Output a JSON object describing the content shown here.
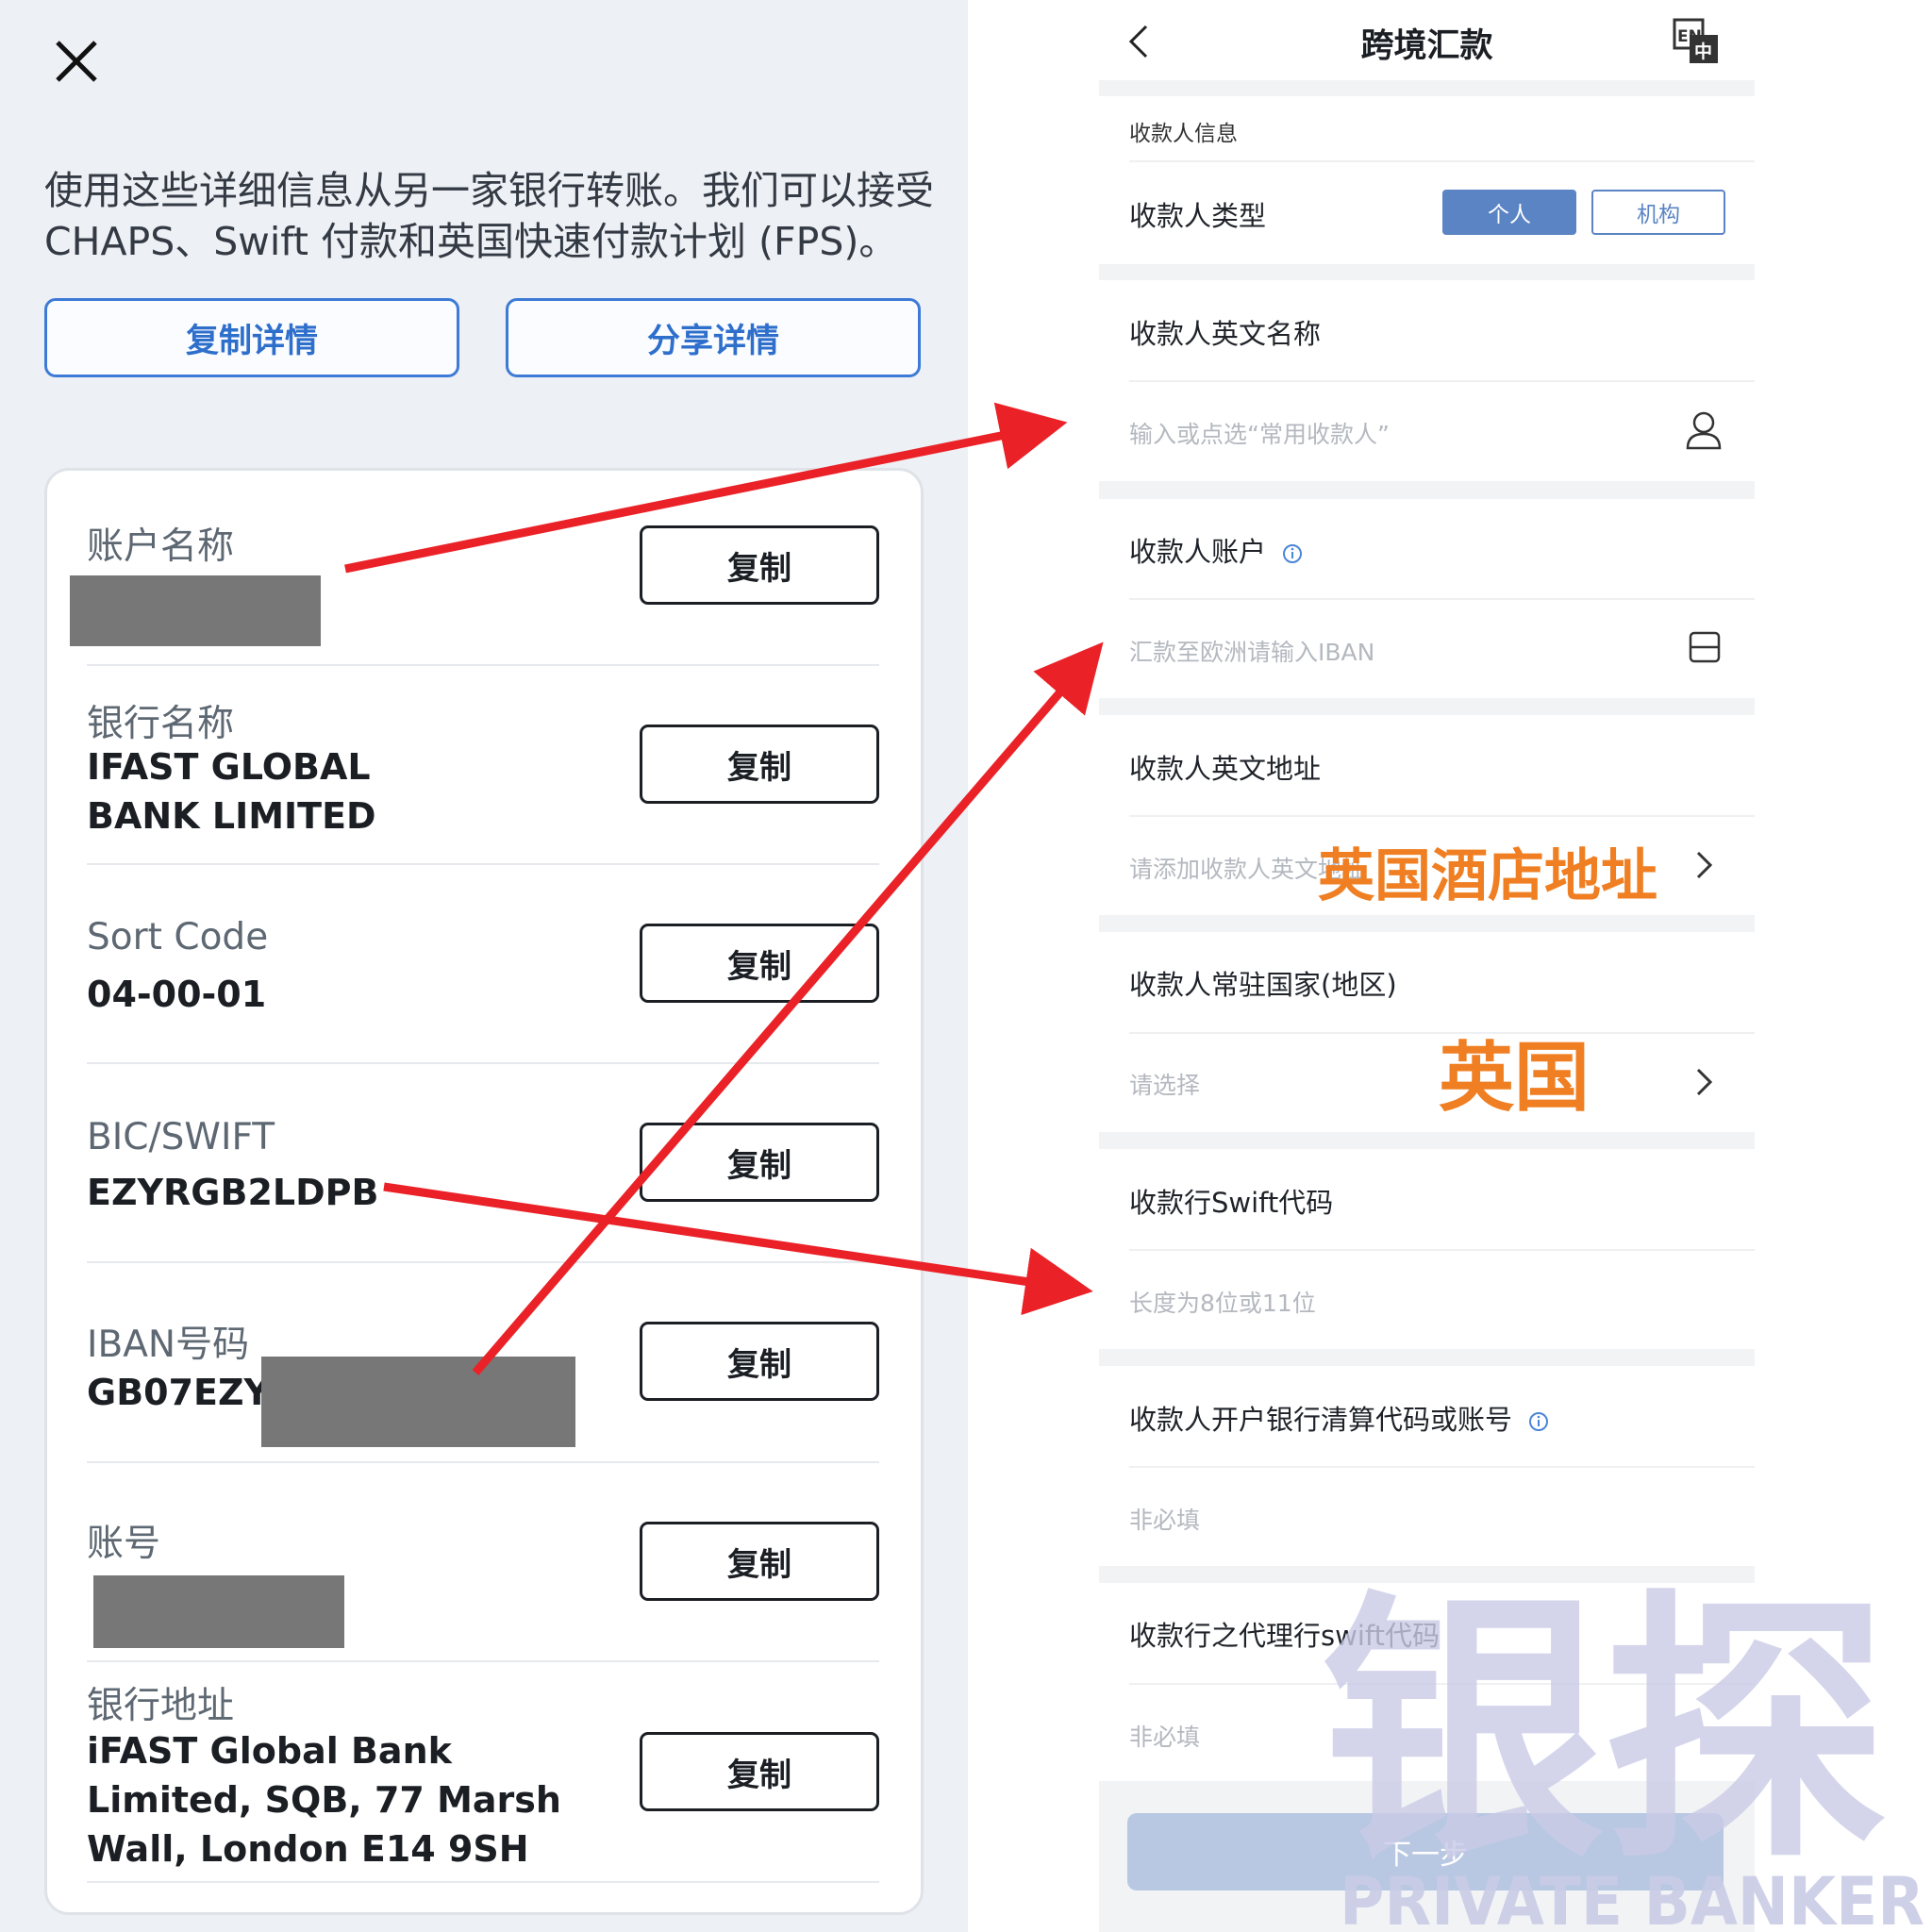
{
  "left_panel": {
    "intro": "使用这些详细信息从另一家银行转账。我们可以接受CHAPS、Swift 付款和英国快速付款计划 (FPS)。",
    "copy_details_label": "复制详情",
    "share_details_label": "分享详情",
    "copy_label": "复制",
    "details": [
      {
        "label": "账户名称",
        "value": ""
      },
      {
        "label": "银行名称",
        "value": "IFAST GLOBAL BANK LIMITED"
      },
      {
        "label": "Sort Code",
        "value": "04-00-01"
      },
      {
        "label": "BIC/SWIFT",
        "value": "EZYRGB2LDPB"
      },
      {
        "label": "IBAN号码",
        "value": "GB07EZYF"
      },
      {
        "label": "账号",
        "value": ""
      },
      {
        "label": "银行地址",
        "value": "iFAST Global Bank Limited, SQB, 77 Marsh Wall, London E14 9SH"
      }
    ]
  },
  "right_panel": {
    "title": "跨境汇款",
    "lang_icon_text_en": "EN",
    "lang_icon_text_zh": "中",
    "section_payee_info": "收款人信息",
    "payee_type_label": "收款人类型",
    "payee_type_options": [
      "个人",
      "机构"
    ],
    "payee_type_selected": "个人",
    "english_name_label": "收款人英文名称",
    "english_name_placeholder": "输入或点选“常用收款人”",
    "account_label": "收款人账户",
    "account_placeholder": "汇款至欧洲请输入IBAN",
    "address_label": "收款人英文地址",
    "address_placeholder": "请添加收款人英文地址",
    "address_overlay": "英国酒店地址",
    "country_label": "收款人常驻国家(地区)",
    "country_placeholder": "请选择",
    "country_overlay": "英国",
    "swift_label": "收款行Swift代码",
    "swift_placeholder": "长度为8位或11位",
    "clearing_label": "收款人开户银行清算代码或账号",
    "clearing_placeholder": "非必填",
    "agent_swift_label": "收款行之代理行swift代码",
    "agent_swift_placeholder": "非必填",
    "next_label": "下一步"
  },
  "watermark": {
    "chinese": "银探",
    "english": "PRIVATE BANKER"
  },
  "colors": {
    "left_bg": "#edf0f4",
    "accent_blue": "#3d7bd6",
    "segment_selected": "#5b84c4",
    "overlay_orange": "#ef7f22",
    "arrow_red": "#ea2228",
    "watermark": "#c9cbe6"
  }
}
